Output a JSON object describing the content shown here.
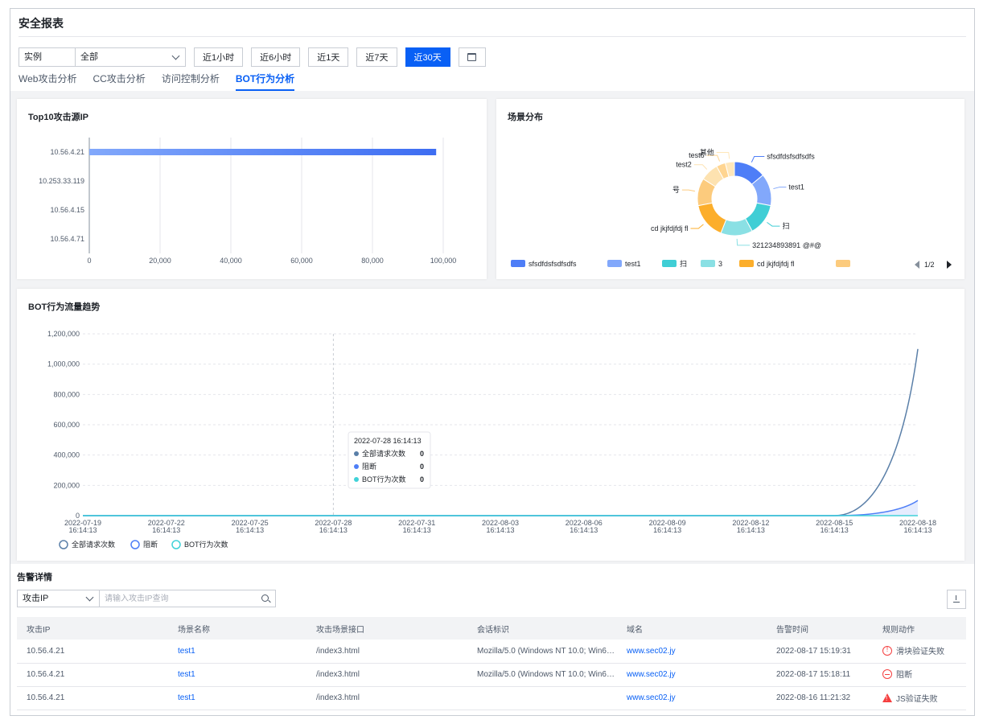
{
  "page": {
    "title": "安全报表"
  },
  "filter": {
    "instance_label": "实例",
    "instance_value": "全部",
    "time_buttons": [
      "近1小时",
      "近6小时",
      "近1天",
      "近7天",
      "近30天"
    ],
    "active_index": 4
  },
  "tabs": [
    {
      "label": "Web攻击分析"
    },
    {
      "label": "CC攻击分析"
    },
    {
      "label": "访问控制分析"
    },
    {
      "label": "BOT行为分析",
      "active": true
    }
  ],
  "top10": {
    "title": "Top10攻击源IP"
  },
  "scene": {
    "title": "场景分布",
    "pager": "1/2"
  },
  "trend": {
    "title": "BOT行为流量趋势",
    "tooltip": {
      "time": "2022-07-28 16:14:13",
      "rows": [
        {
          "name": "全部请求次数",
          "value": "0"
        },
        {
          "name": "阻断",
          "value": "0"
        },
        {
          "name": "BOT行为次数",
          "value": "0"
        }
      ]
    }
  },
  "alerts": {
    "title": "告警详情",
    "search_label": "攻击IP",
    "search_placeholder": "请输入攻击IP查询",
    "columns": [
      "攻击IP",
      "场景名称",
      "攻击场景接口",
      "会话标识",
      "域名",
      "告警时间",
      "规则动作"
    ],
    "rows": [
      {
        "ip": "10.56.4.21",
        "scene": "test1",
        "api": "/index3.html",
        "session": "Mozilla/5.0 (Windows NT 10.0; Win64; ...",
        "domain": "www.sec02.jy",
        "time": "2022-08-17 15:19:31",
        "action": "滑块验证失败",
        "action_icon": "error-circle-icon"
      },
      {
        "ip": "10.56.4.21",
        "scene": "test1",
        "api": "/index3.html",
        "session": "Mozilla/5.0 (Windows NT 10.0; Win64; ...",
        "domain": "www.sec02.jy",
        "time": "2022-08-17 15:18:11",
        "action": "阻断",
        "action_icon": "block-circle-icon"
      },
      {
        "ip": "10.56.4.21",
        "scene": "test1",
        "api": "/index3.html",
        "session": "",
        "domain": "www.sec02.jy",
        "time": "2022-08-16 11:21:32",
        "action": "JS验证失败",
        "action_icon": "warning-triangle-icon"
      }
    ]
  },
  "colors": {
    "primary": "#0960f5",
    "danger": "#f53f3f",
    "series_total": "#5a7fa8",
    "series_block": "#4e7ef7",
    "series_bot": "#40d2d8"
  },
  "chart_data": [
    {
      "type": "bar",
      "orientation": "horizontal",
      "title": "Top10攻击源IP",
      "categories": [
        "10.56.4.21",
        "10.253.33.119",
        "10.56.4.15",
        "10.56.4.71"
      ],
      "values": [
        98000,
        0,
        0,
        0
      ],
      "xlim": [
        0,
        100000
      ],
      "xticks": [
        "0",
        "20,000",
        "40,000",
        "60,000",
        "80,000",
        "100,000"
      ],
      "grid": true
    },
    {
      "type": "pie",
      "title": "场景分布",
      "donut": true,
      "slices": [
        {
          "label": "sfsdfdsfsdfsdfs",
          "value": 14,
          "color": "#4e7ef7"
        },
        {
          "label": "test1",
          "value": 14,
          "color": "#82a8fb"
        },
        {
          "label": "扫",
          "value": 14,
          "color": "#40ced5"
        },
        {
          "label": "321234893891 @#@",
          "value": 14,
          "color": "#8ae0e4"
        },
        {
          "label": "cd jkjfdjfdj fl",
          "value": 16,
          "color": "#fcae2b"
        },
        {
          "label": "号",
          "value": 12,
          "color": "#fccb7d"
        },
        {
          "label": "test2",
          "value": 8,
          "color": "#fde2b0"
        },
        {
          "label": "test6",
          "value": 4,
          "color": "#ffd591"
        },
        {
          "label": "其他",
          "value": 4,
          "color": "#ffe7ba"
        }
      ],
      "legend": [
        "sfsdfdsfsdfsdfs",
        "test1",
        "扫",
        "3",
        "cd jkjfdjfdj fl",
        ""
      ],
      "legend_colors": [
        "#4e7ef7",
        "#82a8fb",
        "#40ced5",
        "#8ae0e4",
        "#fcae2b",
        "#fccb7d"
      ],
      "legend_placement": "bottom"
    },
    {
      "type": "line",
      "title": "BOT行为流量趋势",
      "x": [
        "2022-07-19 16:14:13",
        "2022-07-22 16:14:13",
        "2022-07-25 16:14:13",
        "2022-07-28 16:14:13",
        "2022-07-31 16:14:13",
        "2022-08-03 16:14:13",
        "2022-08-06 16:14:13",
        "2022-08-09 16:14:13",
        "2022-08-12 16:14:13",
        "2022-08-15 16:14:13",
        "2022-08-18 16:14:13"
      ],
      "ylim": [
        0,
        1200000
      ],
      "yticks": [
        "0",
        "200,000",
        "400,000",
        "600,000",
        "800,000",
        "1,000,000",
        "1,200,000"
      ],
      "series": [
        {
          "name": "全部请求次数",
          "values": [
            0,
            0,
            0,
            0,
            0,
            0,
            0,
            0,
            0,
            0,
            1100000
          ],
          "color": "#5a7fa8"
        },
        {
          "name": "阻断",
          "values": [
            0,
            0,
            0,
            0,
            0,
            0,
            0,
            0,
            0,
            0,
            100000
          ],
          "color": "#4e7ef7"
        },
        {
          "name": "BOT行为次数",
          "values": [
            0,
            0,
            0,
            0,
            0,
            0,
            0,
            0,
            0,
            0,
            0
          ],
          "color": "#40d2d8"
        }
      ],
      "legend_placement": "bottom-left",
      "grid": true
    }
  ]
}
